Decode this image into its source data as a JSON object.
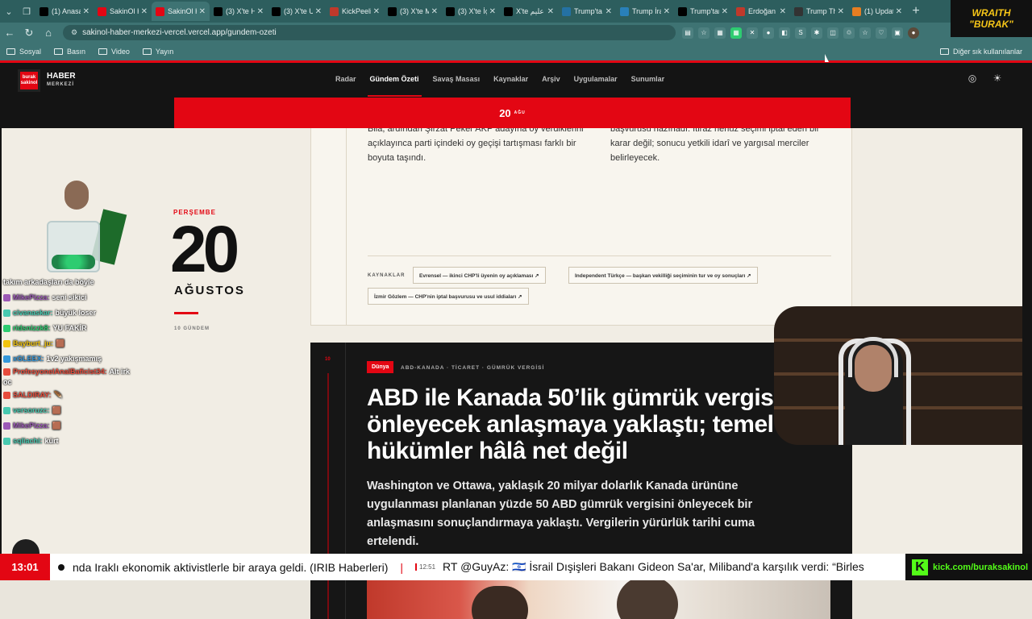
{
  "browser": {
    "tabs": [
      {
        "label": "(1) Anasa",
        "icon": "x-icon",
        "color": "#000"
      },
      {
        "label": "SakinOl H",
        "icon": "sakinol-icon",
        "color": "#e30613"
      },
      {
        "label": "SakinOl H",
        "icon": "sakinol-icon",
        "color": "#e30613",
        "active": true
      },
      {
        "label": "(3) X'te H",
        "icon": "x-icon",
        "color": "#000"
      },
      {
        "label": "(3) X'te U",
        "icon": "x-icon",
        "color": "#000"
      },
      {
        "label": "KickPeeli",
        "icon": "kick-icon",
        "color": "#c0392b"
      },
      {
        "label": "(3) X'te M",
        "icon": "x-icon",
        "color": "#000"
      },
      {
        "label": "(3) X'te İç",
        "icon": "x-icon",
        "color": "#000"
      },
      {
        "label": "X'te عليم",
        "icon": "x-icon",
        "color": "#000"
      },
      {
        "label": "Trump'ta",
        "icon": "news-icon",
        "color": "#2471a3"
      },
      {
        "label": "Trump İra",
        "icon": "o-icon",
        "color": "#2980b9"
      },
      {
        "label": "Trump'tan",
        "icon": "nyt-icon",
        "color": "#000"
      },
      {
        "label": "Erdoğan G",
        "icon": "b-icon",
        "color": "#c0392b"
      },
      {
        "label": "Trump Th",
        "icon": "ws-icon",
        "color": "#333"
      },
      {
        "label": "(1) Updat",
        "icon": "orange-icon",
        "color": "#e67e22"
      }
    ],
    "url": "sakinol-haber-merkezi-vercel.vercel.app/gundem-ozeti",
    "bookmarks": [
      "Sosyal",
      "Basın",
      "Video",
      "Yayın"
    ],
    "other_bookmarks": "Diğer sık kullanılanlar"
  },
  "site": {
    "logo": "burak sakinol",
    "brand_title": "HABER",
    "brand_sub": "MERKEZİ",
    "menu": [
      "Radar",
      "Gündem Özeti",
      "Savaş Masası",
      "Kaynaklar",
      "Arşiv",
      "Uygulamalar",
      "Sunumlar"
    ],
    "active_menu": "Gündem Özeti",
    "date_bar": {
      "day": "20",
      "month": "AĞU"
    }
  },
  "day_panel": {
    "weekday": "PERŞEMBE",
    "day": "20",
    "month": "AĞUSTOS",
    "count": "10 GÜNDEM"
  },
  "prev_card": {
    "left_text": "Bila, ardından Şirzat Peker AKP adayına oy verdiklerini açıklayınca parti içindeki oy geçişi tartışması farklı bir boyuta taşındı.",
    "right_text": "başvurusu hazırladı. İtiraz henüz seçimi iptal eden bir karar değil; sonucu yetkili idarî ve yargısal merciler belirleyecek.",
    "sources_label": "KAYNAKLAR",
    "sources": [
      "Evrensel — ikinci CHP'li üyenin oy açıklaması ↗",
      "Independent Türkçe — başkan vekilliği seçiminin tur ve oy sonuçları ↗",
      "İzmir Gözlem — CHP'nin iptal başvurusu ve usul iddiaları ↗"
    ]
  },
  "story": {
    "number": "10",
    "category": "Dünya",
    "tags": "ABD-KANADA · TİCARET · GÜMRÜK VERGİSİ",
    "headline": "ABD ile Kanada 50’lik gümrük vergisini önleyecek anlaşmaya yaklaştı; temel hükümler hâlâ net değil",
    "lede": "Washington ve Ottawa, yaklaşık 20 milyar dolarlık Kanada ürününe uygulanması planlanan yüzde 50 ABD gümrük vergisini önleyecek bir anlaşmasını sonuçlandırmaya yaklaştı. Vergilerin yürürlük tarihi cuma ertelendi."
  },
  "chat": [
    {
      "user": "",
      "text": "takım arkadaşları da böyle",
      "color": "#fff"
    },
    {
      "user": "MikePizza:",
      "text": "seni sikici",
      "color": "#9b59b6"
    },
    {
      "user": "civanaskar:",
      "text": "büyük loser",
      "color": "#48c9b0"
    },
    {
      "user": "ridsnizzk8:",
      "text": "YU FAKİR",
      "color": "#2ecc71"
    },
    {
      "user": "Bayburt_ju:",
      "text": "🟫",
      "color": "#f1c40f"
    },
    {
      "user": "xGLEEX:",
      "text": "1v2 yakışmamış",
      "color": "#3498db"
    },
    {
      "user": "ProfesyonelAnalBaficist34:",
      "text": "Alt irk oc",
      "color": "#e74c3c"
    },
    {
      "user": "SALDIRAY:",
      "text": "🪶",
      "color": "#e74c3c"
    },
    {
      "user": "versoruzc:",
      "text": "🟫",
      "color": "#48c9b0"
    },
    {
      "user": "MikePizza:",
      "text": "🟫",
      "color": "#9b59b6"
    },
    {
      "user": "sqliachi:",
      "text": "kürt",
      "color": "#48c9b0"
    }
  ],
  "stream": {
    "brand_line1": "WRAITH",
    "brand_line2": "\"BURAK\"",
    "clock": "13:01",
    "ticker1": "nda Iraklı ekonomik aktivistlerle bir araya geldi. (IRIB Haberleri)",
    "ticker_time": "12:51",
    "ticker2": "RT @GuyAz: 🇮🇱 İsrail Dışişleri Bakanı Gideon Sa'ar, Miliband'a karşılık verdi: “Birles",
    "kick": "kick.com/buraksakinol"
  }
}
